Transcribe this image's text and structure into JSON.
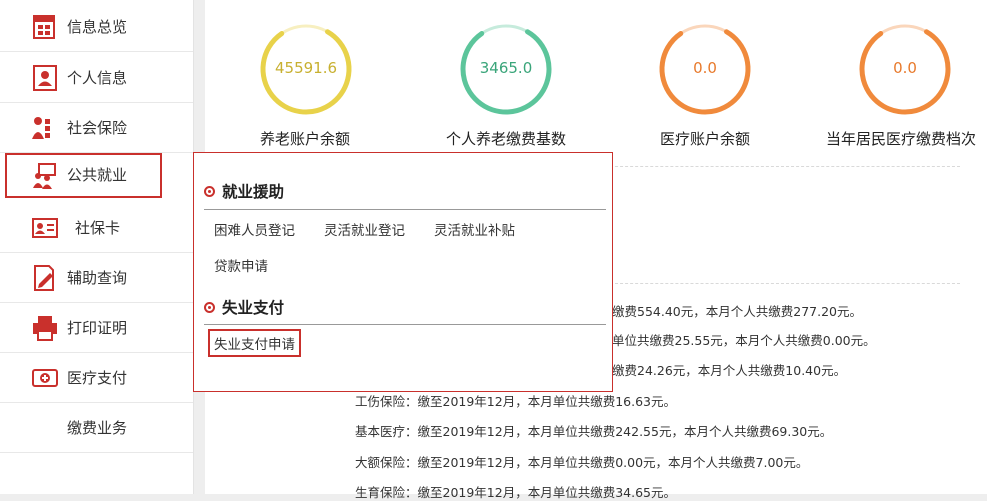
{
  "sidebar": {
    "items": [
      {
        "label": "信息总览",
        "icon": "overview-icon"
      },
      {
        "label": "个人信息",
        "icon": "person-card-icon"
      },
      {
        "label": "社会保险",
        "icon": "insurance-icon"
      },
      {
        "label": "公共就业",
        "icon": "employment-icon"
      },
      {
        "label": "社保卡",
        "icon": "id-card-icon"
      },
      {
        "label": "辅助查询",
        "icon": "document-edit-icon"
      },
      {
        "label": "打印证明",
        "icon": "printer-icon"
      },
      {
        "label": "医疗支付",
        "icon": "medical-payment-icon"
      },
      {
        "label": "缴费业务",
        "icon": ""
      }
    ]
  },
  "stats": [
    {
      "value": "45591.6",
      "label": "养老账户余额",
      "color": "#e8d24a",
      "fraction": 0.82
    },
    {
      "value": "3465.0",
      "label": "个人养老缴费基数",
      "color": "#5cc59b",
      "fraction": 0.82
    },
    {
      "value": "0.0",
      "label": "医疗账户余额",
      "color": "#f08a3c",
      "fraction": 0.82
    },
    {
      "value": "0.0",
      "label": "当年居民医疗缴费档次",
      "color": "#f08a3c",
      "fraction": 0.82
    }
  ],
  "info": {
    "fragments": [
      "缴费554.40元，本月个人共缴费277.20元。",
      "单位共缴费25.55元，本月个人共缴费0.00元。",
      "缴费24.26元，本月个人共缴费10.40元。"
    ],
    "lines": [
      "工伤保险：缴至2019年12月，本月单位共缴费16.63元。",
      "基本医疗：缴至2019年12月，本月单位共缴费242.55元，本月个人共缴费69.30元。",
      "大额保险：缴至2019年12月，本月单位共缴费0.00元，本月个人共缴费7.00元。",
      "生育保险：缴至2019年12月，本月单位共缴费34.65元。"
    ]
  },
  "menu": {
    "section1": {
      "title": "就业援助",
      "links": [
        "困难人员登记",
        "灵活就业登记",
        "灵活就业补贴",
        "贷款申请"
      ]
    },
    "section2": {
      "title": "失业支付",
      "links": [
        "失业支付申请"
      ]
    }
  },
  "colors": {
    "accent": "#c9302c"
  }
}
